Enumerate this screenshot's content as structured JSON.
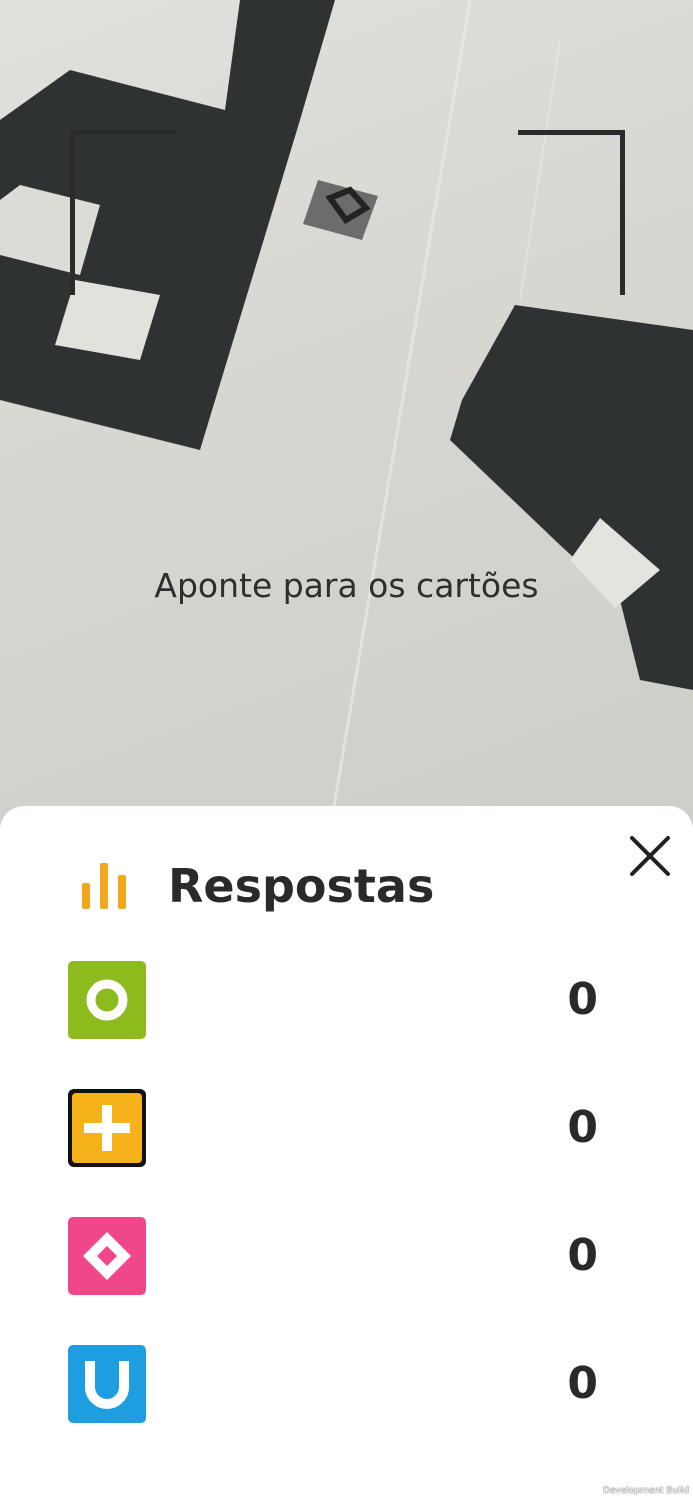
{
  "camera": {
    "hint": "Aponte para os cartões"
  },
  "sheet": {
    "title": "Respostas",
    "title_icon": "bar-chart-icon",
    "close_icon": "close-icon",
    "answers": [
      {
        "icon": "circle-card-icon",
        "color": "#8dbb1e",
        "count": "0"
      },
      {
        "icon": "plus-card-icon",
        "color": "#f6b21b",
        "count": "0"
      },
      {
        "icon": "diamond-card-icon",
        "color": "#f0478a",
        "count": "0"
      },
      {
        "icon": "u-card-icon",
        "color": "#1e9ee0",
        "count": "0"
      }
    ]
  },
  "footer": {
    "build_label": "Development Build"
  }
}
